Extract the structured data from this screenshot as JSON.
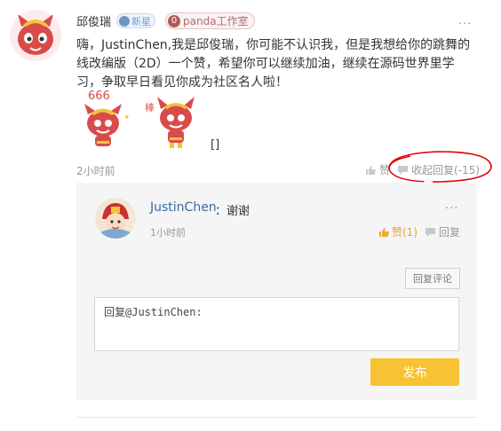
{
  "post": {
    "username": "邱俊瑞",
    "badge_new": "新星",
    "badge_team": "panda工作室",
    "badge_team_count": "0",
    "more": "···",
    "content": "嗨，JustinChen,我是邱俊瑞，你可能不认识我，但是我想给你的跳舞的线改编版（2D）一个赞，希望你可以继续加油，继续在源码世界里学习，争取早日看见你成为社区名人啦！",
    "sticker1_caption": "666",
    "sticker2_caption": "棒",
    "sticker_tail": "[]",
    "time": "2小时前",
    "like_label": "赞",
    "reply_toggle": "收起回复(-15)"
  },
  "reply": {
    "username": "JustinChen",
    "text": "：谢谢",
    "more": "···",
    "time": "1小时前",
    "like_label": "赞(1)",
    "reply_label": "回复",
    "reply_comment_button": "回复评论",
    "input_value": "回复@JustinChen:",
    "publish_button": "发布"
  },
  "colors": {
    "link": "#3b6aa0",
    "accent": "#f7c233",
    "annotation": "#e00000",
    "liked": "#e6a23c"
  }
}
